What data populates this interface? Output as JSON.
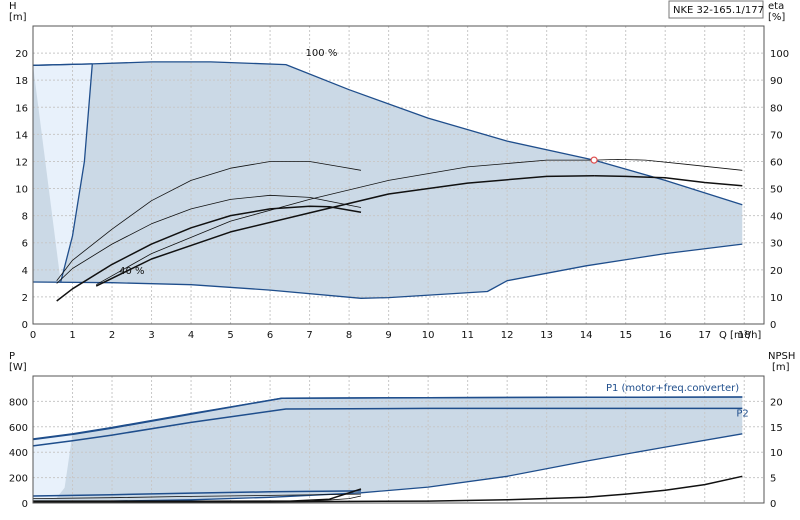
{
  "colors": {
    "envelope_fill": "#cbd9e6",
    "light_fill": "#e8f1fb",
    "blue_line": "#1f4e8c",
    "curve": "#111111",
    "op_point": "#e05050"
  },
  "chart_data": [
    {
      "type": "line",
      "title": "NKE 32-165.1/177",
      "xlabel": "Q [m³/h]",
      "ylabel_left": [
        "H",
        "[m]"
      ],
      "ylabel_right": [
        "eta",
        "[%]"
      ],
      "xlim": [
        0,
        18.5
      ],
      "ylim": [
        0,
        22
      ],
      "ylim_right": [
        0,
        110
      ],
      "x_ticks": [
        0,
        1,
        2,
        3,
        4,
        5,
        6,
        7,
        8,
        9,
        10,
        11,
        12,
        13,
        14,
        15,
        16,
        17,
        18
      ],
      "y_ticks": [
        0,
        2,
        4,
        6,
        8,
        10,
        12,
        14,
        16,
        18,
        20
      ],
      "y_right_ticks": [
        0,
        10,
        20,
        30,
        40,
        50,
        60,
        70,
        80,
        90,
        100
      ],
      "grid": true,
      "annotations": [
        {
          "text": "100 %",
          "x": 7.3,
          "y": 19.8
        },
        {
          "text": "40 %",
          "x": 2.5,
          "y": 3.7
        }
      ],
      "operating_point": {
        "x": 14.2,
        "y": 12.1
      },
      "series": [
        {
          "role": "envelope",
          "upper": [
            [
              0,
              19.1
            ],
            [
              1.5,
              19.2
            ],
            [
              3,
              19.35
            ],
            [
              4.5,
              19.35
            ],
            [
              6.4,
              19.15
            ],
            [
              8,
              17.3
            ],
            [
              10,
              15.2
            ],
            [
              12,
              13.5
            ],
            [
              14.2,
              12.1
            ],
            [
              16,
              10.6
            ],
            [
              17.95,
              8.8
            ]
          ],
          "lower": [
            [
              17.95,
              5.9
            ],
            [
              16,
              5.2
            ],
            [
              14,
              4.3
            ],
            [
              12,
              3.2
            ],
            [
              11.5,
              2.4
            ],
            [
              9,
              1.95
            ],
            [
              8.3,
              1.9
            ],
            [
              6,
              2.5
            ],
            [
              4,
              2.9
            ],
            [
              2,
              3.05
            ],
            [
              0,
              3.1
            ]
          ]
        },
        {
          "role": "light_region",
          "upper": [
            [
              0,
              19.1
            ],
            [
              1.5,
              19.2
            ]
          ],
          "lower": [
            [
              0.7,
              3.1
            ],
            [
              1.0,
              6.5
            ],
            [
              1.3,
              12
            ],
            [
              1.5,
              19.2
            ]
          ]
        },
        {
          "role": "max_head_100",
          "points": [
            [
              14.2,
              12.1
            ],
            [
              14.8,
              12.15
            ],
            [
              15.5,
              12.1
            ],
            [
              16.5,
              11.8
            ],
            [
              17.95,
              11.35
            ]
          ]
        },
        {
          "role": "max_head_100_lower",
          "points": [
            [
              14.2,
              10.95
            ],
            [
              15,
              10.9
            ],
            [
              16,
              10.8
            ],
            [
              17,
              10.45
            ],
            [
              17.95,
              10.2
            ]
          ]
        },
        {
          "role": "head",
          "points": [
            [
              0.6,
              1.7
            ],
            [
              1,
              2.6
            ],
            [
              2,
              4.4
            ],
            [
              3,
              5.9
            ],
            [
              4,
              7.1
            ],
            [
              5,
              8.0
            ],
            [
              6,
              8.5
            ],
            [
              7,
              8.7
            ],
            [
              7.5,
              8.65
            ],
            [
              8.3,
              8.25
            ]
          ]
        },
        {
          "role": "eff_thin_low",
          "points": [
            [
              0.6,
              3.0
            ],
            [
              1,
              4.1
            ],
            [
              2,
              5.9
            ],
            [
              3,
              7.4
            ],
            [
              4,
              8.5
            ],
            [
              5,
              9.2
            ],
            [
              6,
              9.5
            ],
            [
              7,
              9.35
            ],
            [
              8.3,
              8.6
            ]
          ]
        },
        {
          "role": "eff_thin_mid",
          "points": [
            [
              0.6,
              3.2
            ],
            [
              1,
              4.7
            ],
            [
              2,
              7.0
            ],
            [
              3,
              9.1
            ],
            [
              4,
              10.6
            ],
            [
              5,
              11.5
            ],
            [
              6,
              12.0
            ],
            [
              7,
              12.0
            ],
            [
              7.8,
              11.6
            ],
            [
              8.3,
              11.35
            ]
          ]
        },
        {
          "role": "head_mid",
          "points": [
            [
              1.6,
              2.8
            ],
            [
              3,
              4.8
            ],
            [
              5,
              6.8
            ],
            [
              7,
              8.2
            ],
            [
              9,
              9.6
            ],
            [
              11,
              10.4
            ],
            [
              13,
              10.9
            ],
            [
              14.2,
              10.95
            ]
          ]
        },
        {
          "role": "eff_thin_high",
          "points": [
            [
              1.6,
              2.9
            ],
            [
              3,
              5.2
            ],
            [
              5,
              7.6
            ],
            [
              7,
              9.2
            ],
            [
              9,
              10.6
            ],
            [
              11,
              11.6
            ],
            [
              13,
              12.1
            ],
            [
              14.2,
              12.1
            ]
          ]
        }
      ]
    },
    {
      "type": "line",
      "xlim": [
        0,
        18.5
      ],
      "ylim": [
        0,
        1000
      ],
      "ylim_right": [
        0,
        25
      ],
      "ylabel_left": [
        "P",
        "[W]"
      ],
      "ylabel_right": [
        "NPSH",
        "[m]"
      ],
      "y_ticks": [
        0,
        200,
        400,
        600,
        800
      ],
      "y_right_ticks": [
        0,
        5,
        10,
        15,
        20
      ],
      "grid": true,
      "labels": [
        {
          "text": "P1 (motor+freq.converter)",
          "x": 14.5,
          "y": 880
        },
        {
          "text": "P2",
          "x": 17.8,
          "y": 680
        }
      ],
      "series": [
        {
          "role": "power_envelope",
          "upper": [
            [
              0,
              505
            ],
            [
              1,
              545
            ],
            [
              2,
              595
            ],
            [
              4,
              705
            ],
            [
              6.3,
              825
            ],
            [
              10,
              830
            ],
            [
              14,
              833
            ],
            [
              17.95,
              835
            ]
          ],
          "lower": [
            [
              17.95,
              545
            ],
            [
              16,
              440
            ],
            [
              14,
              330
            ],
            [
              12,
              210
            ],
            [
              10,
              125
            ],
            [
              8.3,
              80
            ],
            [
              6,
              45
            ],
            [
              4,
              25
            ],
            [
              2,
              15
            ],
            [
              0,
              5
            ]
          ]
        },
        {
          "role": "light_region",
          "points": [
            [
              0,
              505
            ],
            [
              1,
              545
            ],
            [
              0.8,
              120
            ],
            [
              0.6,
              40
            ],
            [
              0,
              30
            ]
          ]
        },
        {
          "name": "P1",
          "points": [
            [
              0,
              500
            ],
            [
              1,
              540
            ],
            [
              2,
              590
            ],
            [
              4,
              700
            ],
            [
              6.3,
              825
            ],
            [
              10,
              828
            ],
            [
              14,
              832
            ],
            [
              17.95,
              835
            ]
          ]
        },
        {
          "name": "P2",
          "points": [
            [
              0,
              450
            ],
            [
              1,
              490
            ],
            [
              2,
              535
            ],
            [
              4,
              635
            ],
            [
              6.4,
              740
            ],
            [
              10,
              745
            ],
            [
              14,
              745
            ],
            [
              17.95,
              745
            ]
          ]
        },
        {
          "role": "p_low_1",
          "points": [
            [
              0,
              55
            ],
            [
              2,
              65
            ],
            [
              4,
              78
            ],
            [
              6,
              88
            ],
            [
              8.3,
              95
            ]
          ]
        },
        {
          "role": "p_low_2",
          "points": [
            [
              0,
              35
            ],
            [
              2,
              42
            ],
            [
              4,
              52
            ],
            [
              6,
              60
            ],
            [
              8.3,
              70
            ]
          ]
        },
        {
          "role": "npsh_a",
          "points": [
            [
              0,
              15
            ],
            [
              4,
              14
            ],
            [
              6.5,
              15
            ],
            [
              7.5,
              30
            ],
            [
              8.3,
              110
            ]
          ]
        },
        {
          "role": "npsh_b",
          "points": [
            [
              0,
              12
            ],
            [
              4,
              12
            ],
            [
              7,
              13
            ],
            [
              8,
              35
            ],
            [
              8.3,
              55
            ]
          ]
        },
        {
          "role": "npsh_c",
          "points": [
            [
              0,
              10
            ],
            [
              6,
              10
            ],
            [
              10,
              15
            ],
            [
              12,
              25
            ],
            [
              14,
              45
            ],
            [
              15,
              70
            ],
            [
              16,
              100
            ],
            [
              17,
              145
            ],
            [
              17.95,
              210
            ]
          ]
        }
      ]
    }
  ]
}
